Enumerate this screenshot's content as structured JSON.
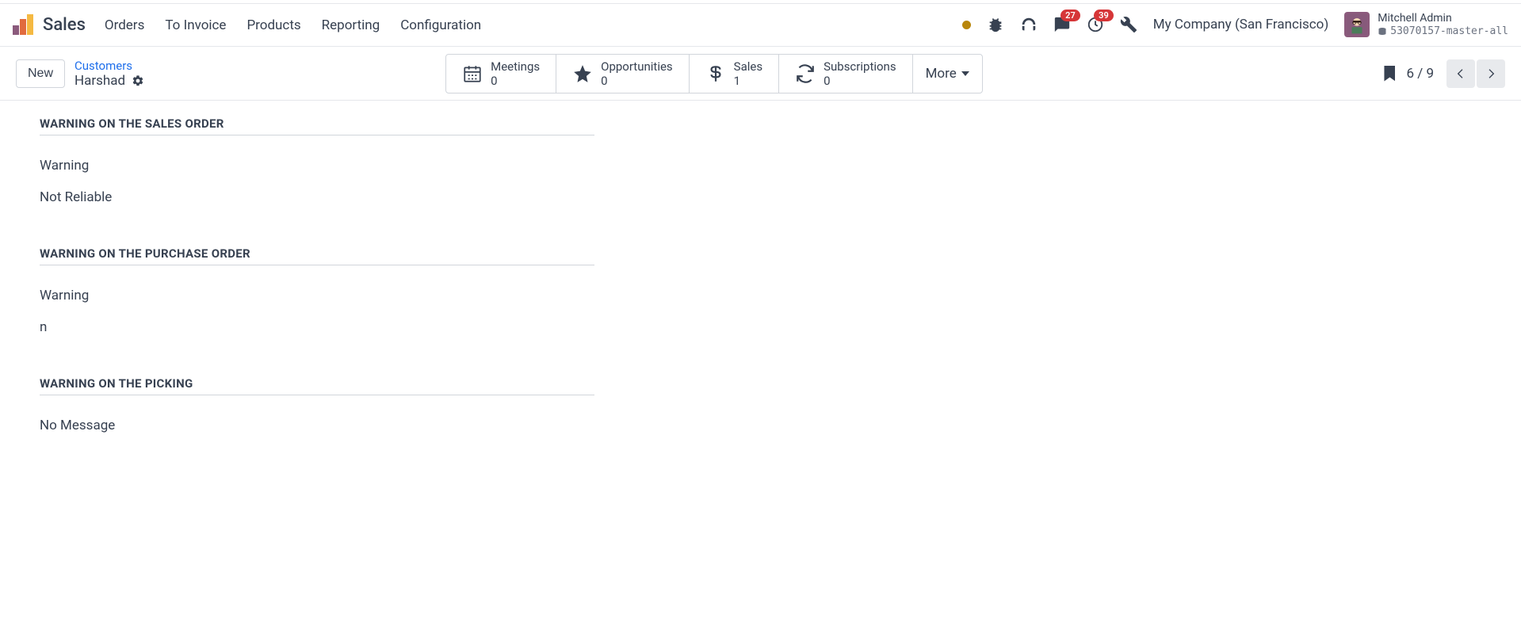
{
  "app": {
    "name": "Sales"
  },
  "nav": {
    "links": [
      "Orders",
      "To Invoice",
      "Products",
      "Reporting",
      "Configuration"
    ]
  },
  "systray": {
    "messages_badge": "27",
    "activities_badge": "39",
    "company": "My Company (San Francisco)",
    "user_name": "Mitchell Admin",
    "db_name": "53070157-master-all"
  },
  "controlbar": {
    "new_label": "New",
    "breadcrumb_root": "Customers",
    "breadcrumb_current": "Harshad",
    "stats": [
      {
        "label": "Meetings",
        "value": "0"
      },
      {
        "label": "Opportunities",
        "value": "0"
      },
      {
        "label": "Sales",
        "value": "1"
      },
      {
        "label": "Subscriptions",
        "value": "0"
      }
    ],
    "more_label": "More",
    "pager": "6 / 9"
  },
  "content": {
    "sections": [
      {
        "title": "WARNING ON THE SALES ORDER",
        "label": "Warning",
        "value": "Not Reliable"
      },
      {
        "title": "WARNING ON THE PURCHASE ORDER",
        "label": "Warning",
        "value": "n"
      },
      {
        "title": "WARNING ON THE PICKING",
        "label": "No Message",
        "value": ""
      }
    ]
  }
}
